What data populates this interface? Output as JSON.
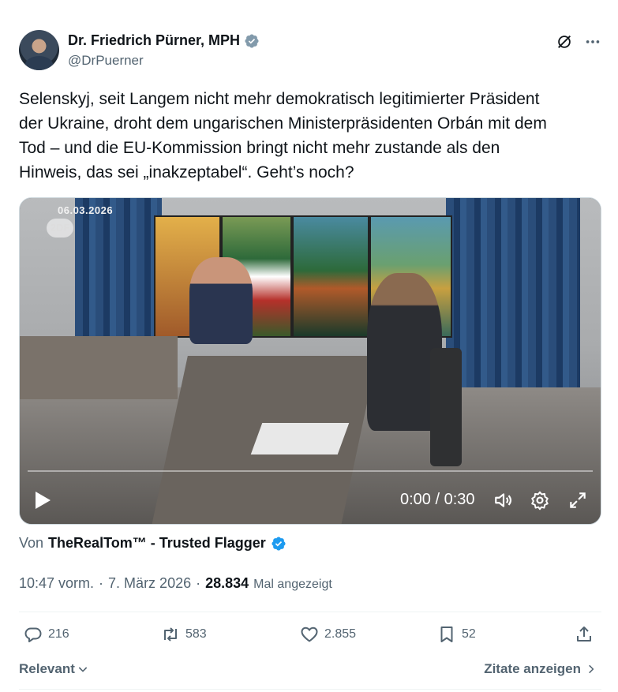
{
  "author": {
    "name": "Dr. Friedrich Pürner, MPH",
    "handle": "@DrPuerner"
  },
  "header": {
    "icons": [
      "grok-icon",
      "more-icon"
    ]
  },
  "tweet": {
    "text_lines": [
      "Selenskyj, seit Langem nicht mehr demokratisch legitimierter Präsident",
      "der Ukraine, droht dem ungarischen Ministerpräsidenten Orbán mit dem",
      "Tod – und die EU-Kommission bringt nicht mehr zustande als den",
      "Hinweis, das sei „inakzeptabel“. Geht’s noch?"
    ]
  },
  "video": {
    "date_stamp": "06.03.2026",
    "channel_logo": "2DF",
    "time": "0:00 / 0:30",
    "progress": 0
  },
  "via": {
    "prefix": "Von",
    "source": "TheRealTom™ - Trusted Flagger"
  },
  "meta": {
    "time": "10:47 vorm.",
    "separator": "·",
    "date": "7. März 2026",
    "views_count": "28.834",
    "views_suffix": "Mal angezeigt"
  },
  "actions": {
    "replies": "216",
    "reposts": "583",
    "likes": "2.855",
    "bookmarks": "52"
  },
  "footer": {
    "sort_label": "Relevant",
    "quotes_label": "Zitate anzeigen"
  },
  "colors": {
    "verified_gray": "#829aab",
    "verified_blue": "#1d9bf0",
    "text": "#0f1419",
    "muted": "#536471"
  }
}
